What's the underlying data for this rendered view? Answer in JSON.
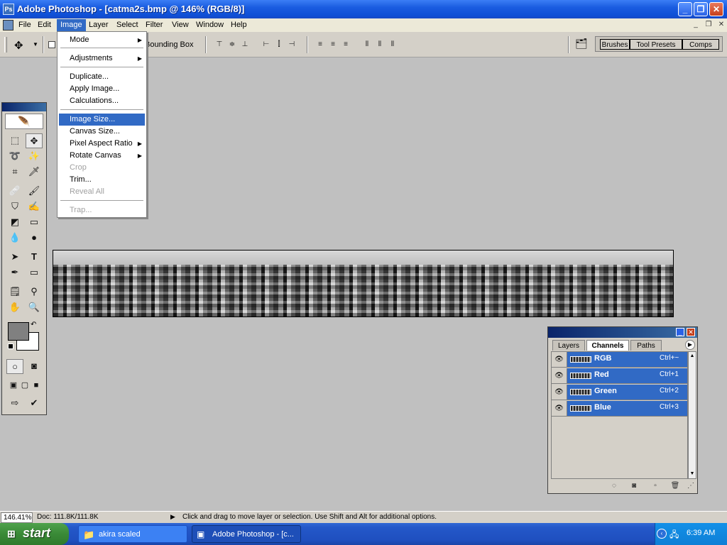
{
  "window": {
    "title": "Adobe Photoshop - [catma2s.bmp @ 146% (RGB/8)]",
    "app_icon": "photoshop-icon",
    "controls": {
      "minimize": "_",
      "restore": "❐",
      "close": "✕"
    }
  },
  "menubar": {
    "items": [
      {
        "name": "file",
        "label": "File"
      },
      {
        "name": "edit",
        "label": "Edit"
      },
      {
        "name": "image",
        "label": "Image",
        "active": true
      },
      {
        "name": "layer",
        "label": "Layer"
      },
      {
        "name": "select",
        "label": "Select"
      },
      {
        "name": "filter",
        "label": "Filter"
      },
      {
        "name": "view",
        "label": "View"
      },
      {
        "name": "window",
        "label": "Window"
      },
      {
        "name": "help",
        "label": "Help"
      }
    ]
  },
  "options_bar": {
    "bounding_box_label": "Bounding Box",
    "well_tabs": [
      "Brushes",
      "Tool Presets",
      "Comps"
    ]
  },
  "image_menu": {
    "items": [
      {
        "label": "Mode",
        "submenu": true
      },
      {
        "label": "Adjustments",
        "submenu": true
      },
      {
        "label": "Duplicate..."
      },
      {
        "label": "Apply Image..."
      },
      {
        "label": "Calculations..."
      },
      {
        "label": "Image Size...",
        "highlighted": true
      },
      {
        "label": "Canvas Size..."
      },
      {
        "label": "Pixel Aspect Ratio",
        "submenu": true
      },
      {
        "label": "Rotate Canvas",
        "submenu": true
      },
      {
        "label": "Crop",
        "disabled": true
      },
      {
        "label": "Trim..."
      },
      {
        "label": "Reveal All",
        "disabled": true
      },
      {
        "label": "Trap...",
        "disabled": true
      }
    ]
  },
  "channels_panel": {
    "tabs": [
      "Layers",
      "Channels",
      "Paths"
    ],
    "active_tab": "Channels",
    "channels": [
      {
        "name": "RGB",
        "shortcut": "Ctrl+~"
      },
      {
        "name": "Red",
        "shortcut": "Ctrl+1"
      },
      {
        "name": "Green",
        "shortcut": "Ctrl+2"
      },
      {
        "name": "Blue",
        "shortcut": "Ctrl+3"
      }
    ]
  },
  "statusbar": {
    "zoom": "146.41%",
    "doc": "Doc: 111.8K/111.8K",
    "hint": "Click and drag to move layer or selection.  Use Shift and Alt for additional options."
  },
  "taskbar": {
    "start_label": "start",
    "tasks": [
      {
        "label": "akira scaled",
        "active": false
      },
      {
        "label": "Adobe Photoshop - [c...",
        "active": true
      }
    ],
    "clock": "6:39 AM"
  },
  "colors": {
    "accent": "#316ac5",
    "titlebar": "#0f4fd6",
    "workspace": "#c0c0c0",
    "foreground_swatch": "#808080",
    "background_swatch": "#ffffff"
  }
}
